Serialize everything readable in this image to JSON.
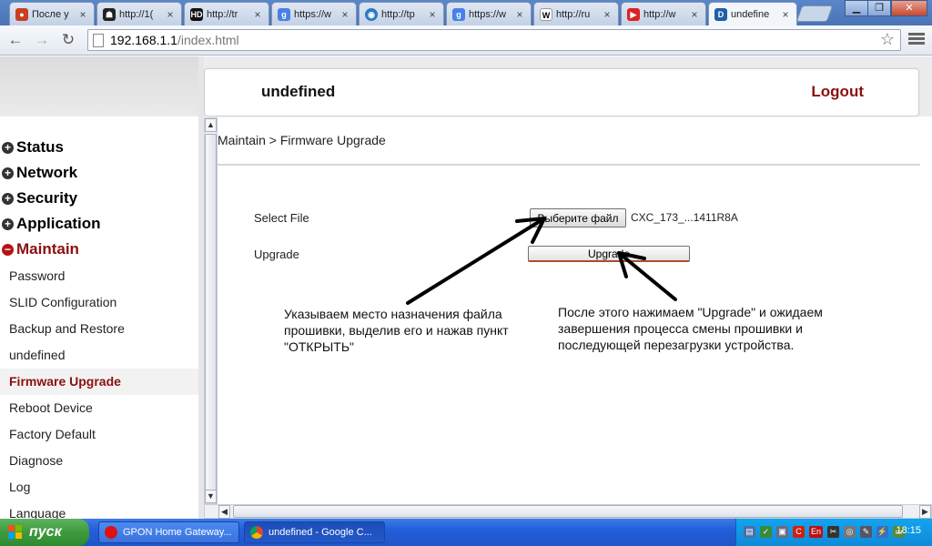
{
  "browser": {
    "tabs": [
      {
        "title": "После у",
        "icon": "fire-icon",
        "color": "#c8401f"
      },
      {
        "title": "http://1(",
        "icon": "spy-icon",
        "color": "#222222"
      },
      {
        "title": "http://tr",
        "icon": "hd-icon",
        "color": "#111111"
      },
      {
        "title": "https://w",
        "icon": "google-icon",
        "color": "#4a80e6"
      },
      {
        "title": "http://tp",
        "icon": "drupal-icon",
        "color": "#2b7ac7"
      },
      {
        "title": "https://w",
        "icon": "google-icon",
        "color": "#4a80e6"
      },
      {
        "title": "http://ru",
        "icon": "wikipedia-icon",
        "color": "#ffffff"
      },
      {
        "title": "http://w",
        "icon": "youtube-icon",
        "color": "#d22"
      },
      {
        "title": "undefine",
        "icon": "router-icon",
        "color": "#1e5fa8"
      }
    ],
    "url_host": "192.168.1.1",
    "url_path": "/index.html"
  },
  "header": {
    "device_name": "undefined",
    "logout": "Logout"
  },
  "sidebar": {
    "sections": [
      {
        "label": "Status",
        "expanded": false
      },
      {
        "label": "Network",
        "expanded": false
      },
      {
        "label": "Security",
        "expanded": false
      },
      {
        "label": "Application",
        "expanded": false
      },
      {
        "label": "Maintain",
        "expanded": true
      }
    ],
    "items": [
      {
        "label": "Password"
      },
      {
        "label": "SLID Configuration"
      },
      {
        "label": "Backup and Restore"
      },
      {
        "label": "undefined"
      },
      {
        "label": "Firmware Upgrade",
        "selected": true
      },
      {
        "label": "Reboot Device"
      },
      {
        "label": "Factory Default"
      },
      {
        "label": "Diagnose"
      },
      {
        "label": "Log"
      },
      {
        "label": "Language"
      }
    ]
  },
  "content": {
    "breadcrumb": "Maintain > Firmware Upgrade",
    "select_file_label": "Select File",
    "choose_file_button": "Выберите файл",
    "file_name": "CXC_173_...1411R8A",
    "upgrade_label": "Upgrade",
    "upgrade_button": "Upgrade",
    "note_left": "Указываем место назначения файла прошивки, выделив его и нажав пункт \"ОТКРЫТЬ\"",
    "note_right": "После этого нажимаем \"Upgrade\" и ожидаем завершения процесса смены прошивки и последующей перезагрузки устройства."
  },
  "taskbar": {
    "start": "пуск",
    "tasks": [
      {
        "label": "GPON Home Gateway...",
        "icon": "opera-icon"
      },
      {
        "label": "undefined - Google C...",
        "icon": "chrome-icon"
      }
    ],
    "clock": "18:15",
    "tray_lang": "En"
  },
  "colors": {
    "accent": "#8b1010",
    "taskbar": "#245edb",
    "start": "#3c9a3c"
  }
}
